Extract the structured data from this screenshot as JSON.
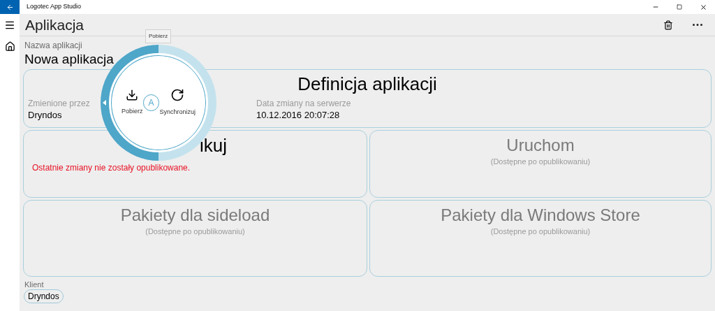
{
  "window": {
    "title": "Logotec App Studio"
  },
  "page": {
    "title": "Aplikacja"
  },
  "app_name": {
    "label": "Nazwa aplikacji",
    "value": "Nowa aplikacja"
  },
  "tiles": [
    {
      "kind": "definition",
      "title": "Definicja aplikacji",
      "fields": [
        {
          "label": "Zmienione przez",
          "value": "Dryndos"
        },
        {
          "label": "Data zmiany na serwerze",
          "value": "10.12.2016 20:07:28"
        }
      ]
    },
    {
      "kind": "publish",
      "title": "ikuj",
      "warning": "Ostatnie zmiany nie zostały opublikowane."
    },
    {
      "kind": "unavailable",
      "title": "Uruchom",
      "note": "(Dostępne po opublikowaniu)"
    },
    {
      "kind": "unavailable",
      "title": "Pakiety dla sideload",
      "note": "(Dostępne po opublikowaniu)"
    },
    {
      "kind": "unavailable",
      "title": "Pakiety dla Windows Store",
      "note": "(Dostępne po opublikowaniu)"
    }
  ],
  "client": {
    "label": "Klient",
    "chips": [
      "Dryndos"
    ]
  },
  "radial_menu": {
    "tooltip": "Pobierz",
    "center": "A",
    "items": [
      {
        "kind": "download",
        "label": "Pobierz"
      },
      {
        "kind": "sync",
        "label": "Synchronizuj"
      }
    ]
  }
}
